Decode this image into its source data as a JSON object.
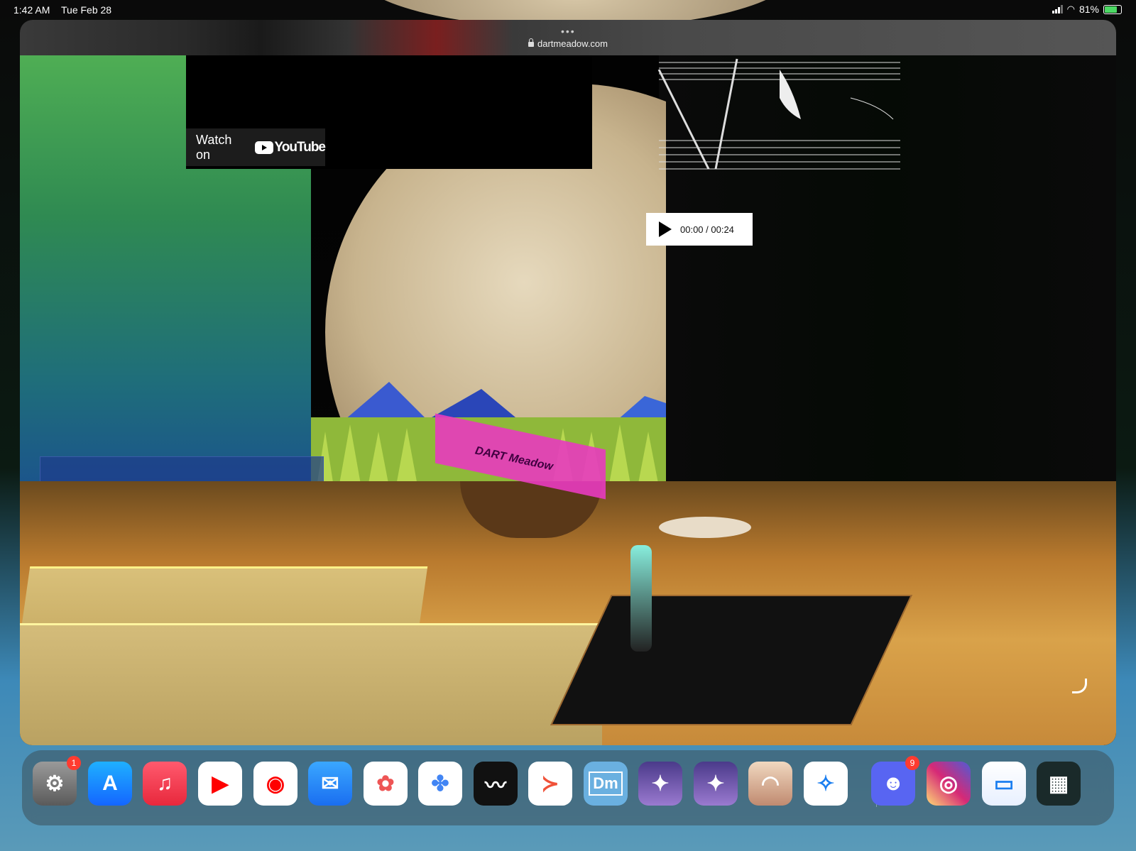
{
  "status_bar": {
    "time": "1:42 AM",
    "date": "Tue Feb 28",
    "battery": "81%"
  },
  "browser": {
    "url": "dartmeadow.com",
    "menu_dots": "•••"
  },
  "youtube": {
    "watch_label": "Watch on",
    "brand": "YouTube"
  },
  "audio_player": {
    "time": "00:00 / 00:24"
  },
  "scene": {
    "sail_text": "DART Meadow"
  },
  "dock": {
    "apps": [
      {
        "name": "Settings",
        "icon": "gear-icon",
        "badge": "1"
      },
      {
        "name": "App Store",
        "icon": "app-store-icon"
      },
      {
        "name": "Music",
        "icon": "music-note-icon"
      },
      {
        "name": "YouTube",
        "icon": "youtube-icon"
      },
      {
        "name": "YouTube Music",
        "icon": "youtube-music-icon"
      },
      {
        "name": "Mail",
        "icon": "mail-icon"
      },
      {
        "name": "Photos",
        "icon": "photos-icon"
      },
      {
        "name": "Google Photos",
        "icon": "google-photos-icon"
      },
      {
        "name": "Procreate",
        "icon": "procreate-icon"
      },
      {
        "name": "Swift Playgrounds",
        "icon": "swift-icon"
      },
      {
        "name": "Dm",
        "icon": "dm-icon",
        "label": "Dm"
      },
      {
        "name": "Game 1",
        "icon": "game-icon"
      },
      {
        "name": "Game 2",
        "icon": "game-icon"
      },
      {
        "name": "Sky",
        "icon": "sky-icon"
      },
      {
        "name": "Safari",
        "icon": "safari-icon"
      },
      {
        "name": "Discord",
        "icon": "discord-icon",
        "badge": "9"
      },
      {
        "name": "Instagram",
        "icon": "instagram-icon"
      },
      {
        "name": "Files",
        "icon": "folder-icon"
      },
      {
        "name": "App Library",
        "icon": "app-library-icon"
      }
    ]
  }
}
